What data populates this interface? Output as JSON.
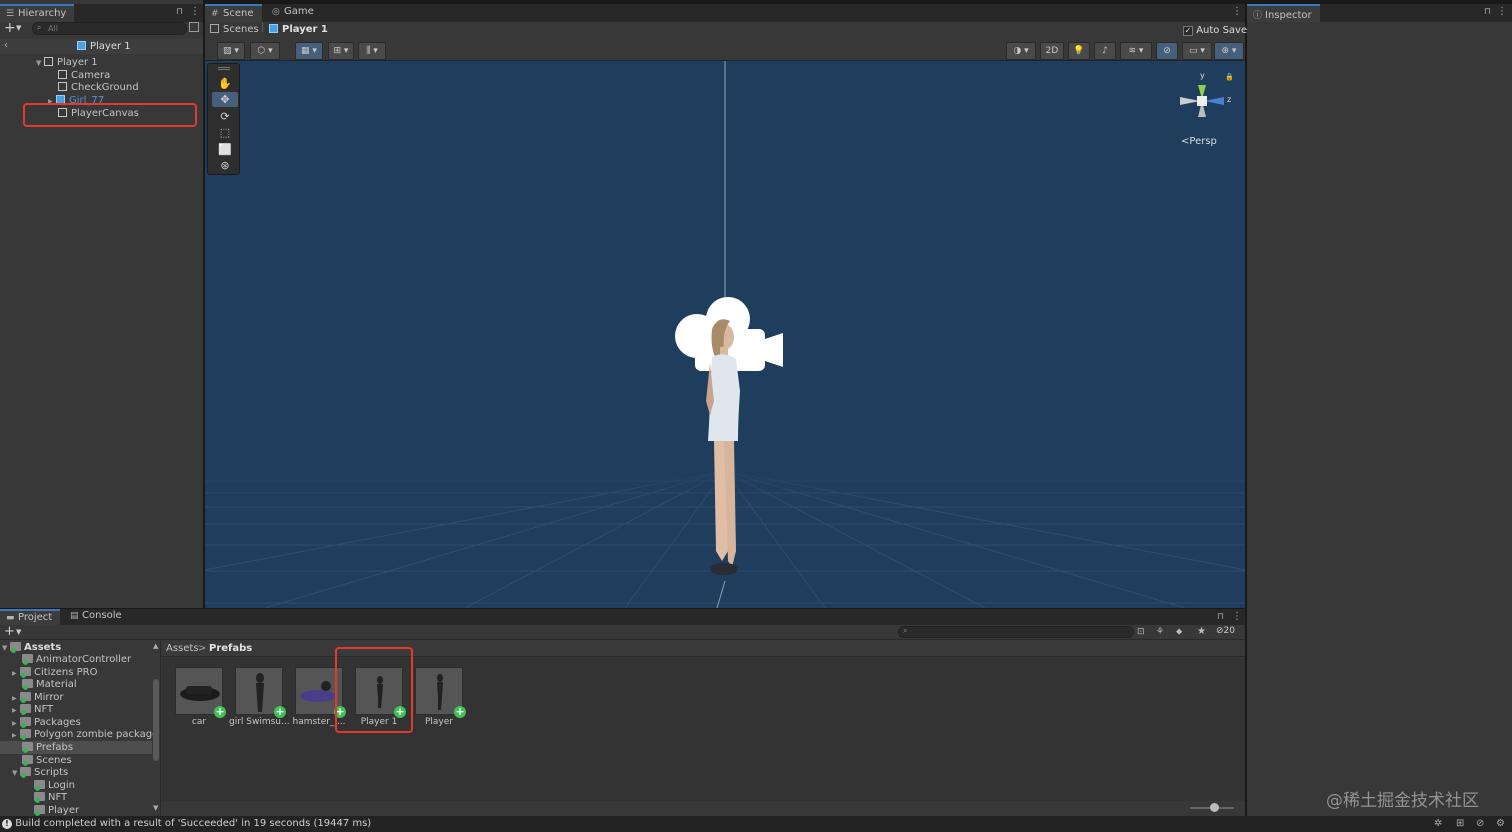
{
  "hierarchy": {
    "tab_label": "Hierarchy",
    "search_placeholder": "All",
    "scene_title": "Player 1",
    "items": [
      {
        "label": "Player 1"
      },
      {
        "label": "Camera"
      },
      {
        "label": "CheckGround"
      },
      {
        "label": "Girl_77"
      },
      {
        "label": "PlayerCanvas"
      }
    ]
  },
  "scene": {
    "tabs": [
      {
        "label": "Scene"
      },
      {
        "label": "Game"
      }
    ],
    "breadcrumb": {
      "root": "Scenes",
      "current": "Player 1"
    },
    "auto_save_label": "Auto Save",
    "auto_save_checked": true,
    "toggle_2d_label": "2D",
    "gizmo": {
      "y": "y",
      "z": "z",
      "persp_label": "Persp"
    },
    "background_color": "#1f3d5c"
  },
  "inspector": {
    "tab_label": "Inspector"
  },
  "project": {
    "tabs": [
      {
        "label": "Project"
      },
      {
        "label": "Console"
      }
    ],
    "hidden_count": "20",
    "tree": {
      "root": "Assets",
      "items": [
        {
          "label": "AnimatorController"
        },
        {
          "label": "Citizens PRO"
        },
        {
          "label": "Material"
        },
        {
          "label": "Mirror"
        },
        {
          "label": "NFT"
        },
        {
          "label": "Packages"
        },
        {
          "label": "Polygon zombie package"
        },
        {
          "label": "Prefabs"
        },
        {
          "label": "Scenes"
        },
        {
          "label": "Scripts"
        },
        {
          "label": "Login"
        },
        {
          "label": "NFT"
        },
        {
          "label": "Player"
        }
      ]
    },
    "breadcrumb": {
      "root": "Assets",
      "separator": ">",
      "current": "Prefabs"
    },
    "assets": [
      {
        "label": "car"
      },
      {
        "label": "girl Swimsu..."
      },
      {
        "label": "hamster_l..."
      },
      {
        "label": "Player 1"
      },
      {
        "label": "Player"
      }
    ]
  },
  "status_bar": {
    "message": "Build completed with a result of 'Succeeded' in 19 seconds (19447 ms)"
  },
  "watermark": "@稀土掘金技术社区",
  "accent_color": "#3a79bb",
  "highlight_color": "#e23b2e"
}
